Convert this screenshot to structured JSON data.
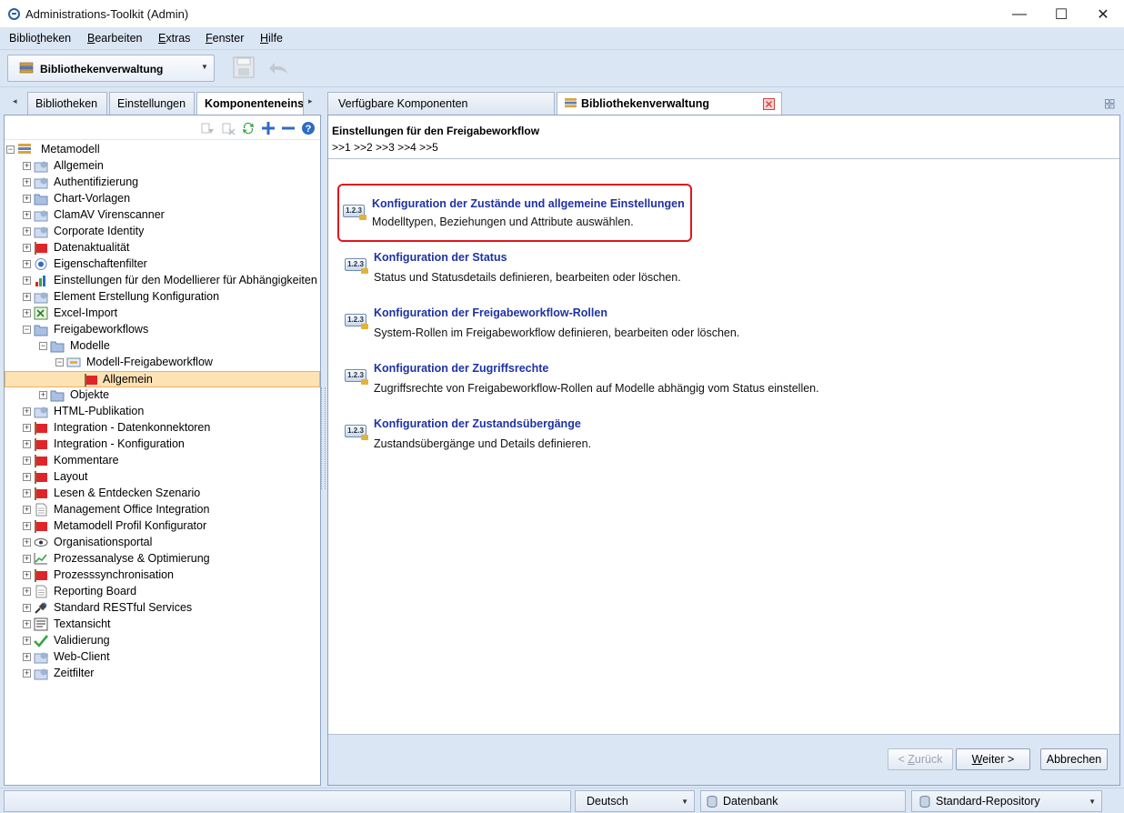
{
  "window": {
    "title": "Administrations-Toolkit (Admin)",
    "controls": {
      "minimize": "—",
      "maximize": "☐",
      "close": "✕"
    }
  },
  "menu": [
    {
      "pre": "Biblio",
      "u": "t",
      "post": "heken"
    },
    {
      "pre": "",
      "u": "B",
      "post": "earbeiten"
    },
    {
      "pre": "",
      "u": "E",
      "post": "xtras"
    },
    {
      "pre": "",
      "u": "F",
      "post": "enster"
    },
    {
      "pre": "",
      "u": "H",
      "post": "ilfe"
    }
  ],
  "toolbar": {
    "combo_label": "Bibliothekenverwaltung"
  },
  "left_tabs": {
    "bibliotheken": "Bibliotheken",
    "einstellungen": "Einstellungen",
    "komponenten": "Komponenteneinst"
  },
  "tree": {
    "root": "Metamodell",
    "nodes": [
      "Allgemein",
      "Authentifizierung",
      "Chart-Vorlagen",
      "ClamAV Virenscanner",
      "Corporate Identity",
      "Datenaktualität",
      "Eigenschaftenfilter",
      "Einstellungen für den Modellierer für Abhängigkeiten",
      "Element Erstellung Konfiguration",
      "Excel-Import",
      "Freigabeworkflows",
      "Modelle",
      "Modell-Freigabeworkflow",
      "Allgemein",
      "Objekte",
      "HTML-Publikation",
      "Integration - Datenkonnektoren",
      "Integration - Konfiguration",
      "Kommentare",
      "Layout",
      "Lesen & Entdecken Szenario",
      "Management Office Integration",
      "Metamodell Profil Konfigurator",
      "Organisationsportal",
      "Prozessanalyse & Optimierung",
      "Prozesssynchronisation",
      "Reporting Board",
      "Standard RESTful Services",
      "Textansicht",
      "Validierung",
      "Web-Client",
      "Zeitfilter"
    ]
  },
  "right_tabs": {
    "available": "Verfügbare Komponenten",
    "library": "Bibliothekenverwaltung"
  },
  "content": {
    "section_title": "Einstellungen für den Freigabeworkflow",
    "steps": ">>1 >>2 >>3 >>4 >>5",
    "icon_text": "1.2.3",
    "items": [
      {
        "title": "Konfiguration der Zustände und allgemeine Einstellungen",
        "desc": "Modelltypen, Beziehungen und Attribute auswählen."
      },
      {
        "title": "Konfiguration der Status",
        "desc": "Status und Statusdetails definieren, bearbeiten oder löschen."
      },
      {
        "title": "Konfiguration der Freigabeworkflow-Rollen",
        "desc": "System-Rollen im Freigabeworkflow definieren, bearbeiten oder löschen."
      },
      {
        "title": "Konfiguration der Zugriffsrechte",
        "desc": "Zugriffsrechte von Freigabeworkflow-Rollen auf Modelle abhängig vom Status einstellen."
      },
      {
        "title": "Konfiguration der Zustandsübergänge",
        "desc": "Zustandsübergänge und Details definieren."
      }
    ]
  },
  "footer": {
    "back": {
      "u": "Z",
      "pre": "< ",
      "post": "urück"
    },
    "next": {
      "u": "W",
      "pre": "",
      "post": "eiter >"
    },
    "cancel": "Abbrechen"
  },
  "status": {
    "language": "Deutsch",
    "database": "Datenbank",
    "repository": "Standard-Repository"
  },
  "colors": {
    "accent": "#1f32a3",
    "highlight": "#e0161d",
    "selection": "#fde2b4",
    "chrome": "#dbe6f4"
  }
}
